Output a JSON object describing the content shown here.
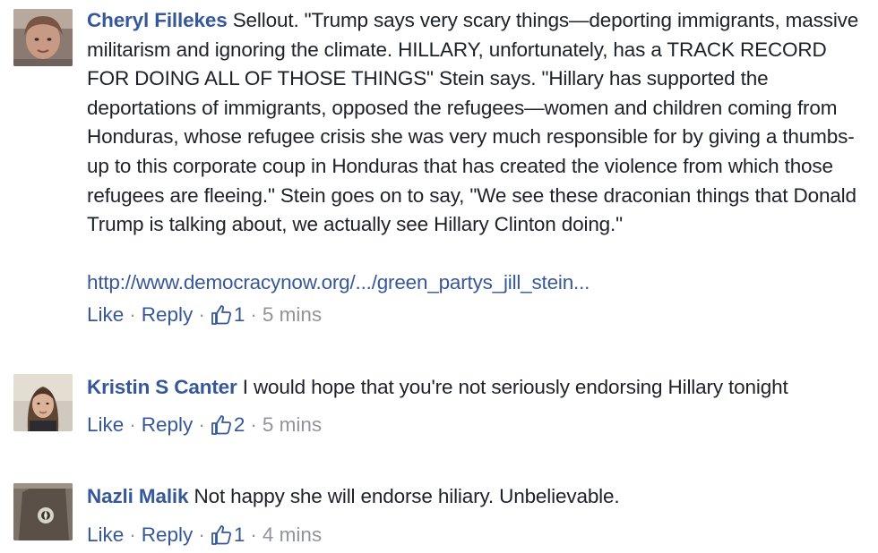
{
  "comments": [
    {
      "author": "Cheryl Fillekes",
      "text": "Sellout. \"Trump says very scary things—deporting immigrants, massive militarism and ignoring the climate. HILLARY, unfortunately, has a TRACK RECORD FOR DOING ALL OF THOSE THINGS\" Stein says. \"Hillary has supported the deportations of immigrants, opposed the refugees—women and children coming from Honduras, whose refugee crisis she was very much responsible for by giving a thumbs-up to this corporate coup in Honduras that has created the violence from which those refugees are fleeing.\" Stein goes on to say, \"We see these draconian things that Donald Trump is talking about, we actually see Hillary Clinton doing.\"",
      "link": "http://www.democracynow.org/.../green_partys_jill_stein...",
      "like_label": "Like",
      "reply_label": "Reply",
      "like_count": "1",
      "time": "5 mins",
      "like_icon": "thumbs-up-icon"
    },
    {
      "author": "Kristin S Canter",
      "text": "I would hope that you're not seriously endorsing Hillary tonight",
      "like_label": "Like",
      "reply_label": "Reply",
      "like_count": "2",
      "time": "5 mins",
      "like_icon": "thumbs-up-icon"
    },
    {
      "author": "Nazli Malik",
      "text": "Not happy she will endorse hiliary. Unbelievable.",
      "like_label": "Like",
      "reply_label": "Reply",
      "like_count": "1",
      "time": "4 mins",
      "like_icon": "thumbs-up-icon"
    }
  ],
  "separator": "·",
  "colors": {
    "link": "#365899",
    "text": "#1d2129",
    "meta": "#90949c"
  }
}
